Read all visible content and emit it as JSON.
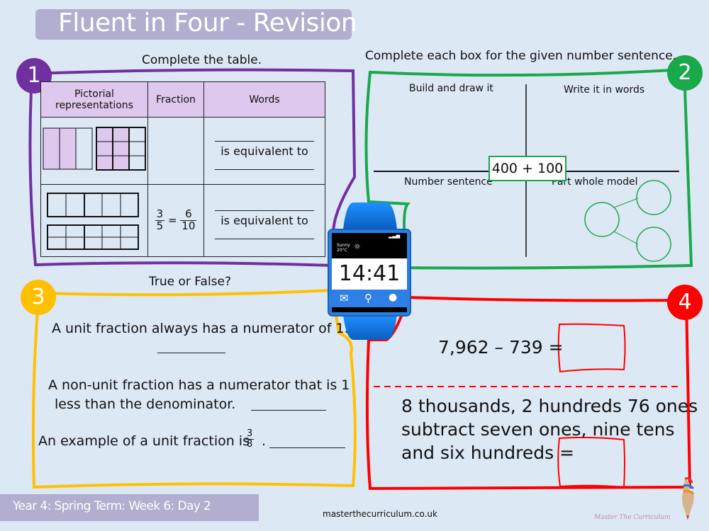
{
  "header": {
    "title": "Fluent in Four - Revision"
  },
  "colors": {
    "q1": "#7030a0",
    "q2": "#19a84a",
    "q3": "#ffc000",
    "q4": "#ff0000",
    "title_bar": "#b1aecf",
    "table_header": "#dfc8ee",
    "background": "#dde8f5"
  },
  "q1": {
    "badge": "1",
    "instruction": "Complete the table.",
    "columns": [
      "Pictorial representations",
      "Fraction",
      "Words"
    ],
    "rows": [
      {
        "fraction_shown": false,
        "words": "is equivalent to",
        "shaded": "2/3 = 6/9"
      },
      {
        "fraction_left_num": "3",
        "fraction_left_den": "5",
        "equals": "=",
        "fraction_right_num": "6",
        "fraction_right_den": "10",
        "words": "is equivalent to"
      }
    ]
  },
  "q2": {
    "badge": "2",
    "instruction": "Complete each box for the given number sentence.",
    "quadrants": [
      "Build and draw it",
      "Write it in words",
      "Number sentence",
      "Part whole model"
    ],
    "number_sentence": "400 + 100"
  },
  "q3": {
    "badge": "3",
    "instruction": "True or False?",
    "statements": [
      "A unit fraction always has a numerator of 1.",
      "A non-unit fraction has a numerator that is 1",
      "less than the denominator.",
      "An example of a unit fraction is"
    ],
    "fraction_num": "3",
    "fraction_den": "8",
    "period": "."
  },
  "q4": {
    "badge": "4",
    "equation": "7,962 – 739 =",
    "word_problem": [
      "8 thousands, 2 hundreds 76 ones",
      "subtract seven ones, nine tens",
      "and six hundreds ="
    ]
  },
  "watch": {
    "weather": "Sunny",
    "temp": "20°C",
    "time": "14:41",
    "icons": [
      "mail-icon",
      "search-icon",
      "user-icon"
    ]
  },
  "footer": {
    "lesson": "Year 4: Spring Term: Week 6: Day 2",
    "website": "masterthecurriculum.co.uk",
    "brand": "Master The Curriculum"
  }
}
